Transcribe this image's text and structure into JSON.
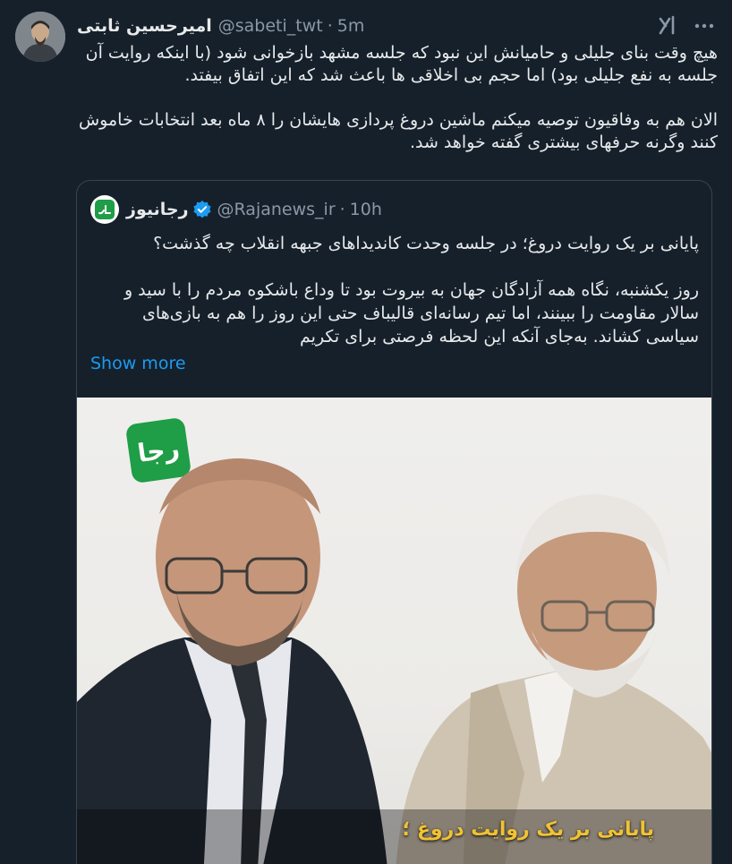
{
  "tweet": {
    "author_name": "امیرحسین ثابتی",
    "author_handle": "@sabeti_twt",
    "separator": "·",
    "time": "5m",
    "text": "هیچ وقت بنای جلیلی و حامیانش این نبود که جلسه مشهد بازخوانی شود (با اینکه روایت آن جلسه به نفع جلیلی بود) اما حجم بی اخلاقی ها باعث شد که این اتفاق بیفتد.\n\nالان هم به وفاقیون توصیه میکنم ماشین دروغ پردازی هایشان را ۸ ماه بعد انتخابات خاموش کنند وگرنه حرفهای بیشتری گفته خواهد شد.",
    "icons": {
      "avatar": "avatar",
      "grok": "grok-icon",
      "more": "more-icon"
    }
  },
  "quote": {
    "author_name": "رجانیوز",
    "author_handle": "@Rajanews_ir",
    "separator": "·",
    "time": "10h",
    "text": "پایانی بر یک روایت دروغ؛ در جلسه وحدت کاندیداهای جبهه انقلاب چه گذشت؟\n\nروز یکشنبه، نگاه همه آزادگان جهان به بیروت بود تا وداع باشکوه مردم را با سید و سالار مقاومت را ببینند، اما تیم رسانه‌ای قالیباف حتی این روز را هم به بازی‌های سیاسی کشاند. به‌جای آنکه این لحظه فرصتی برای تکریم",
    "show_more": "Show more",
    "media": {
      "logo_text": "رجا",
      "caption": "پایانی بر یک روایت دروغ ؛"
    },
    "icons": {
      "verified": "verified-icon",
      "logo": "rajanews-logo-icon"
    }
  },
  "colors": {
    "background": "#15202b",
    "text": "#e7e9ea",
    "muted": "#8b98a5",
    "link": "#1d9bf0",
    "border": "#38444d",
    "logo_green": "#1f9d47",
    "caption": "#f1c232"
  }
}
